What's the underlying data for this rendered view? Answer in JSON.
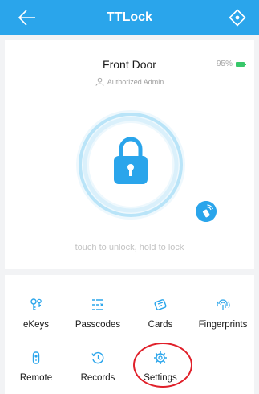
{
  "header": {
    "title": "TTLock",
    "background_color": "#2aa5eb",
    "back_icon": "arrow-left-icon",
    "scan_icon": "scan-icon"
  },
  "lock": {
    "name": "Front Door",
    "battery": "95%",
    "role": "Authorized Admin",
    "hint": "touch to unlock, hold to lock",
    "battery_color": "#38c76a"
  },
  "features": [
    {
      "label": "eKeys",
      "icon": "ekey-icon"
    },
    {
      "label": "Passcodes",
      "icon": "passcode-icon"
    },
    {
      "label": "Cards",
      "icon": "card-icon"
    },
    {
      "label": "Fingerprints",
      "icon": "fingerprint-icon"
    },
    {
      "label": "Remote",
      "icon": "remote-icon"
    },
    {
      "label": "Records",
      "icon": "records-icon"
    },
    {
      "label": "Settings",
      "icon": "settings-icon"
    }
  ],
  "highlight_color": "#e0202a"
}
